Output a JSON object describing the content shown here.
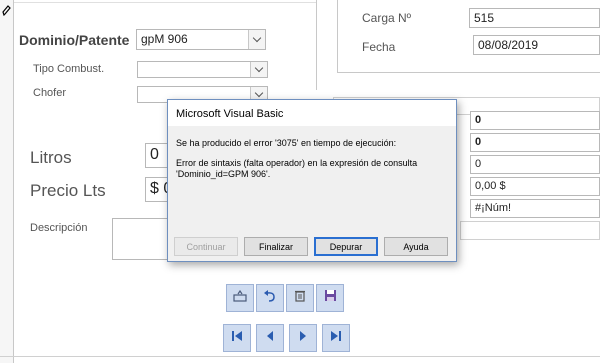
{
  "record_selector": {
    "icon": "pencil-icon"
  },
  "form": {
    "dominio_label": "Dominio/Patente",
    "dominio_value": "gpM 906",
    "tipo_combust_label": "Tipo Combust.",
    "tipo_combust_value": "",
    "chofer_label": "Chofer",
    "chofer_value": "",
    "litros_label": "Litros",
    "litros_value": "0",
    "precio_label": "Precio Lts",
    "precio_value": "$ 0",
    "descripcion_label": "Descripción",
    "carga_label": "Carga Nº",
    "carga_value": "515",
    "fecha_label": "Fecha",
    "fecha_value": "08/08/2019",
    "right_values": [
      "0",
      "0",
      "0",
      "0,00 $",
      "#¡Núm!"
    ]
  },
  "toolbar": {
    "icons": [
      "add-record-icon",
      "undo-icon",
      "delete-icon",
      "save-icon"
    ]
  },
  "navigation": {
    "icons": [
      "first-record-icon",
      "previous-record-icon",
      "next-record-icon",
      "last-record-icon"
    ]
  },
  "dialog": {
    "title": "Microsoft Visual Basic",
    "message_line1": "Se ha producido el error '3075' en tiempo de ejecución:",
    "message_line2": "Error de sintaxis (falta operador) en la expresión de consulta",
    "message_line3": "'Dominio_id=GPM 906'.",
    "buttons": {
      "continuar": "Continuar",
      "finalizar": "Finalizar",
      "depurar": "Depurar",
      "ayuda": "Ayuda"
    }
  }
}
